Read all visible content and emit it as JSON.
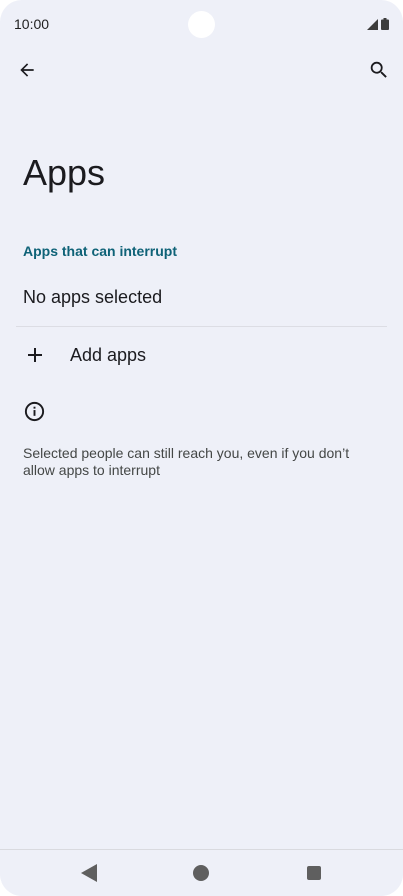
{
  "status_bar": {
    "time": "10:00"
  },
  "app_bar": {
    "back_icon": "arrow-back-icon",
    "search_icon": "search-icon"
  },
  "page": {
    "title": "Apps",
    "section_header": "Apps that can interrupt",
    "empty_text": "No apps selected",
    "add_label": "Add apps",
    "add_icon": "plus-icon",
    "info_icon": "info-icon",
    "footer_text": "Selected people can still reach you, even if you don’t allow apps to interrupt"
  },
  "colors": {
    "background": "#eef0f8",
    "accent": "#0e6277",
    "text": "#1b1b1f"
  }
}
